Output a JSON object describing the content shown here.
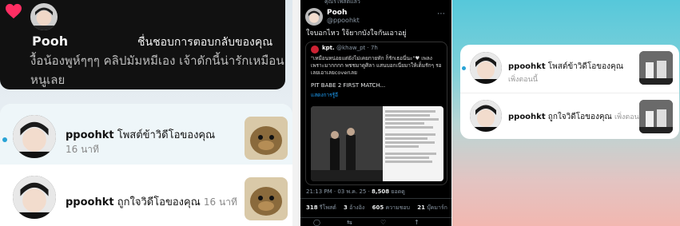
{
  "left": {
    "dark_notification": {
      "name": "Pooh",
      "action": "ชื่นชอบการตอบกลับของคุณ",
      "message": "งื้อน้องพูห์ๆๆๆ คลิปมัมหมีเอง เจ้าดักนี้น่ารักเหมือนหนูเลย"
    },
    "notifications": [
      {
        "user": "ppoohkt",
        "action": "โพสต์ข้าวิดีโอของคุณ",
        "time": "16 นาที",
        "unread": true
      },
      {
        "user": "ppoohkt",
        "action": "ถูกใจวิดีโอของคุณ",
        "time": "16 นาที",
        "unread": false
      }
    ]
  },
  "middle": {
    "top_note": "คุณรีโพสต์แล้ว",
    "name": "Pooh",
    "handle": "@ppoohkt",
    "tweet": "ใจบอกไหว ใจ้ยากบังใจกันเอาอยู่",
    "quote": {
      "name": "kpt.",
      "handle": "@khaw_pt · 7h",
      "text": "\"เหมือนหน่อยแต่ยังไม่เคยกายทัก ก็รักเธอนี่นะ\"♥ เพลงเพราะมากกกก พชชมาดูศิลา แสนบอกเนี่ยมาให้เต็มรักๆ รอเลยเอาเลยcoverเลย",
      "title": "PIT BABE 2 FIRST MATCH...",
      "more": "แสดงการรู้อี"
    },
    "meta": {
      "time": "21:13 PM · 03 พ.ค. 25 ·",
      "views": "8,508",
      "views_label": "ยอดดู"
    },
    "stats": [
      {
        "count": "318",
        "label": "รีโพสต์"
      },
      {
        "count": "3",
        "label": "อ้างอิง"
      },
      {
        "count": "605",
        "label": "ความชอบ"
      },
      {
        "count": "21",
        "label": "บุ๊คมาร์ก"
      }
    ]
  },
  "right": {
    "notifications": [
      {
        "user": "ppoohkt",
        "action": "โพสต์ข้าวิดีโอของคุณ",
        "time": "เพิ่งตอนนี้",
        "unread": true
      },
      {
        "user": "ppoohkt",
        "action": "ถูกใจวิดีโอของคุณ",
        "time": "เพิ่งตอนนี้",
        "unread": false
      }
    ]
  },
  "colors": {
    "unread_dot": "#29a3d6",
    "heart": "#ff2e63",
    "link": "#1d9bf0"
  }
}
